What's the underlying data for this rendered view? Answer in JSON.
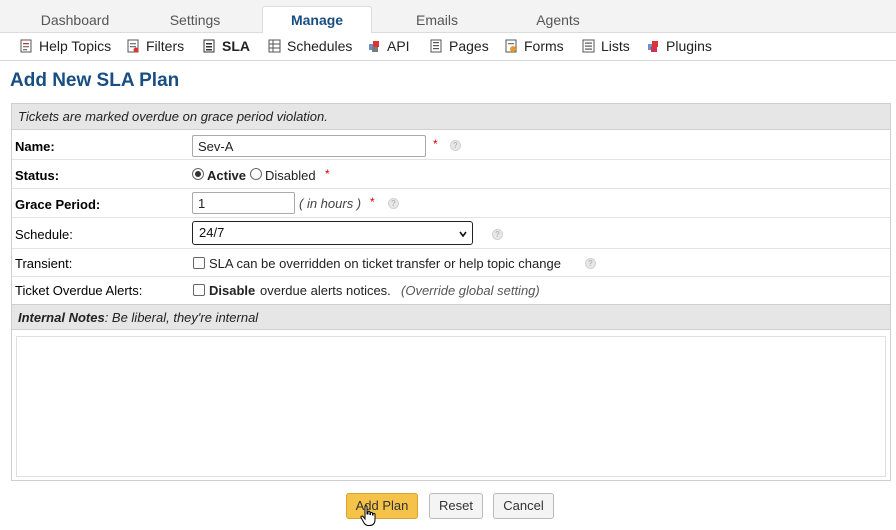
{
  "tabs": [
    {
      "label": "Dashboard"
    },
    {
      "label": "Settings"
    },
    {
      "label": "Manage"
    },
    {
      "label": "Emails"
    },
    {
      "label": "Agents"
    }
  ],
  "active_tab": "Manage",
  "subnav": [
    {
      "label": "Help Topics",
      "icon": "help-topics-icon"
    },
    {
      "label": "Filters",
      "icon": "filters-icon"
    },
    {
      "label": "SLA",
      "icon": "sla-icon"
    },
    {
      "label": "Schedules",
      "icon": "schedules-icon"
    },
    {
      "label": "API",
      "icon": "api-icon"
    },
    {
      "label": "Pages",
      "icon": "pages-icon"
    },
    {
      "label": "Forms",
      "icon": "forms-icon"
    },
    {
      "label": "Lists",
      "icon": "lists-icon"
    },
    {
      "label": "Plugins",
      "icon": "plugins-icon"
    }
  ],
  "active_subnav": "SLA",
  "page_title": "Add New SLA Plan",
  "form": {
    "header_note": "Tickets are marked overdue on grace period violation.",
    "name": {
      "label": "Name:",
      "value": "Sev-A",
      "required": "*"
    },
    "status": {
      "label": "Status:",
      "active_label": "Active",
      "disabled_label": "Disabled",
      "selected": "Active",
      "required": "*"
    },
    "grace_period": {
      "label": "Grace Period:",
      "value": "1",
      "hint": "( in hours )",
      "required": "*"
    },
    "schedule": {
      "label": "Schedule:",
      "selected": "24/7"
    },
    "transient": {
      "label": "Transient:",
      "checkbox_text": "SLA can be overridden on ticket transfer or help topic change",
      "checked": false
    },
    "overdue_alerts": {
      "label": "Ticket Overdue Alerts:",
      "bold_text": "Disable",
      "text": "overdue alerts notices.",
      "hint": "(Override global setting)",
      "checked": false
    },
    "internal_notes": {
      "title": "Internal Notes",
      "hint": ": Be liberal, they're internal",
      "value": ""
    }
  },
  "buttons": {
    "add": "Add Plan",
    "reset": "Reset",
    "cancel": "Cancel"
  },
  "colors": {
    "accent": "#184e81",
    "primary_button": "#f6c34a",
    "required": "#dd0000"
  }
}
